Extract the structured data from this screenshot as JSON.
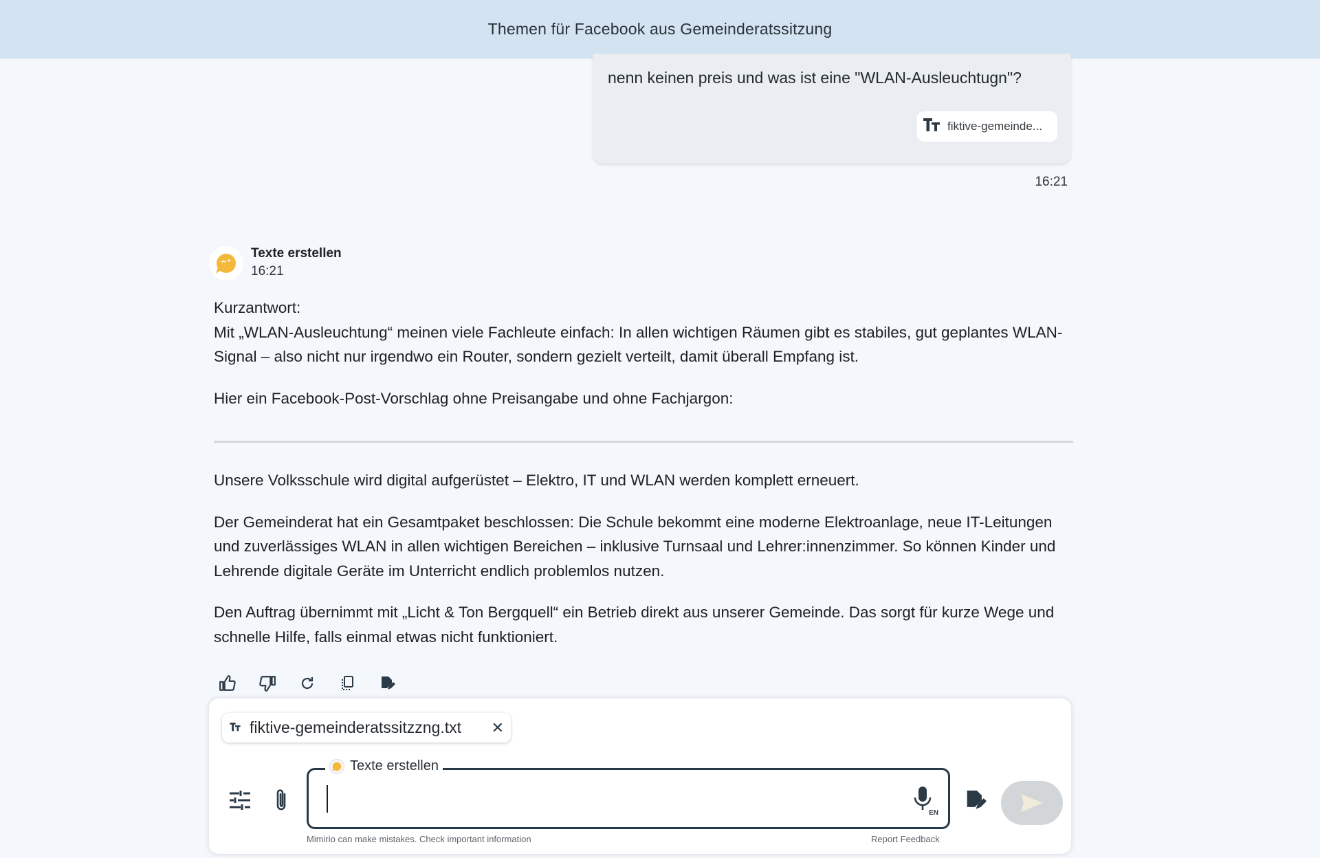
{
  "header": {
    "title": "Themen für Facebook aus Gemeinderatssitzung"
  },
  "user_message": {
    "text": "nenn keinen preis und was ist eine \"WLAN-Ausleuchtugn\"?",
    "attachment_label": "fiktive-gemeinde...",
    "attachment_icon": "text-format-icon",
    "time": "16:21"
  },
  "assistant": {
    "name": "Texte erstellen",
    "time": "16:21",
    "avatar_icon": "speech-bubble-avatar",
    "accent_color": "#f4b93a",
    "paragraphs_before_rule": [
      {
        "lines": [
          "Kurzantwort:",
          "Mit „WLAN-Ausleuchtung“ meinen viele Fachleute einfach: In allen wichtigen Räumen gibt es stabiles, gut geplantes WLAN-Signal – also nicht nur irgendwo ein Router, sondern gezielt verteilt, damit überall Empfang ist."
        ]
      },
      {
        "lines": [
          "Hier ein Facebook-Post-Vorschlag ohne Preisangabe und ohne Fachjargon:"
        ]
      }
    ],
    "paragraphs_after_rule": [
      "Unsere Volksschule wird digital aufgerüstet – Elektro, IT und WLAN werden komplett erneuert.",
      "Der Gemeinderat hat ein Gesamtpaket beschlossen: Die Schule bekommt eine moderne Elektroanlage, neue IT-Leitungen und zuverlässiges WLAN in allen wichtigen Bereichen – inklusive Turnsaal und Lehrer:innenzimmer. So können Kinder und Lehrende digitale Geräte im Unterricht endlich problemlos nutzen.",
      "Den Auftrag übernimmt mit „Licht & Ton Bergquell“ ein Betrieb direkt aus unserer Gemeinde. Das sorgt für kurze Wege und schnelle Hilfe, falls einmal etwas nicht funktioniert."
    ],
    "actions": [
      "thumbs-up-icon",
      "thumbs-down-icon",
      "regenerate-icon",
      "copy-icon",
      "edit-document-icon"
    ]
  },
  "composer": {
    "attachment_name": "fiktive-gemeinderatssitzzng.txt",
    "mode_label": "Texte erstellen",
    "input_value": "",
    "mic_language": "EN",
    "disclaimer": "Mimirio can make mistakes. Check important information",
    "report_label": "Report Feedback",
    "icons": [
      "settings-sliders-icon",
      "paperclip-icon",
      "microphone-icon",
      "edit-document-icon",
      "send-icon"
    ]
  }
}
